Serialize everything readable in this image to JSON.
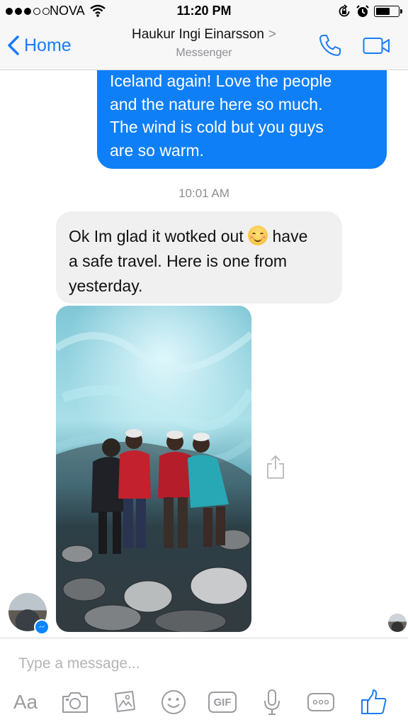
{
  "status_bar": {
    "carrier": "NOVA",
    "time": "11:20 PM",
    "signal_bars": 3,
    "battery_level": 0.55
  },
  "nav": {
    "back_label": "Home",
    "contact_name": "Haukur Ingi Einarsson",
    "contact_chevron": ">",
    "subtitle": "Messenger"
  },
  "conversation": {
    "outgoing_message_lines": [
      "Iceland again! Love the people",
      "and the nature here so much.",
      "The wind is cold but you guys",
      "are so warm."
    ],
    "timestamp": "10:01 AM",
    "incoming_message_parts": {
      "before_emoji": "Ok Im glad it wotked out ",
      "after_emoji": " have",
      "line2": "a safe travel. Here is one from",
      "line3": "yesterday."
    }
  },
  "composer": {
    "placeholder": "Type a message...",
    "aa_label": "Aa",
    "gif_label": "GIF",
    "icons": [
      "aa-icon",
      "camera-icon",
      "gallery-icon",
      "emoji-icon",
      "gif-icon",
      "microphone-icon",
      "more-icon",
      "thumbs-up-icon"
    ]
  },
  "colors": {
    "accent": "#1a7cf5",
    "outgoing_bubble": "#0f7ff7",
    "incoming_bubble": "#f1f0f0",
    "muted": "#8e8e93"
  }
}
